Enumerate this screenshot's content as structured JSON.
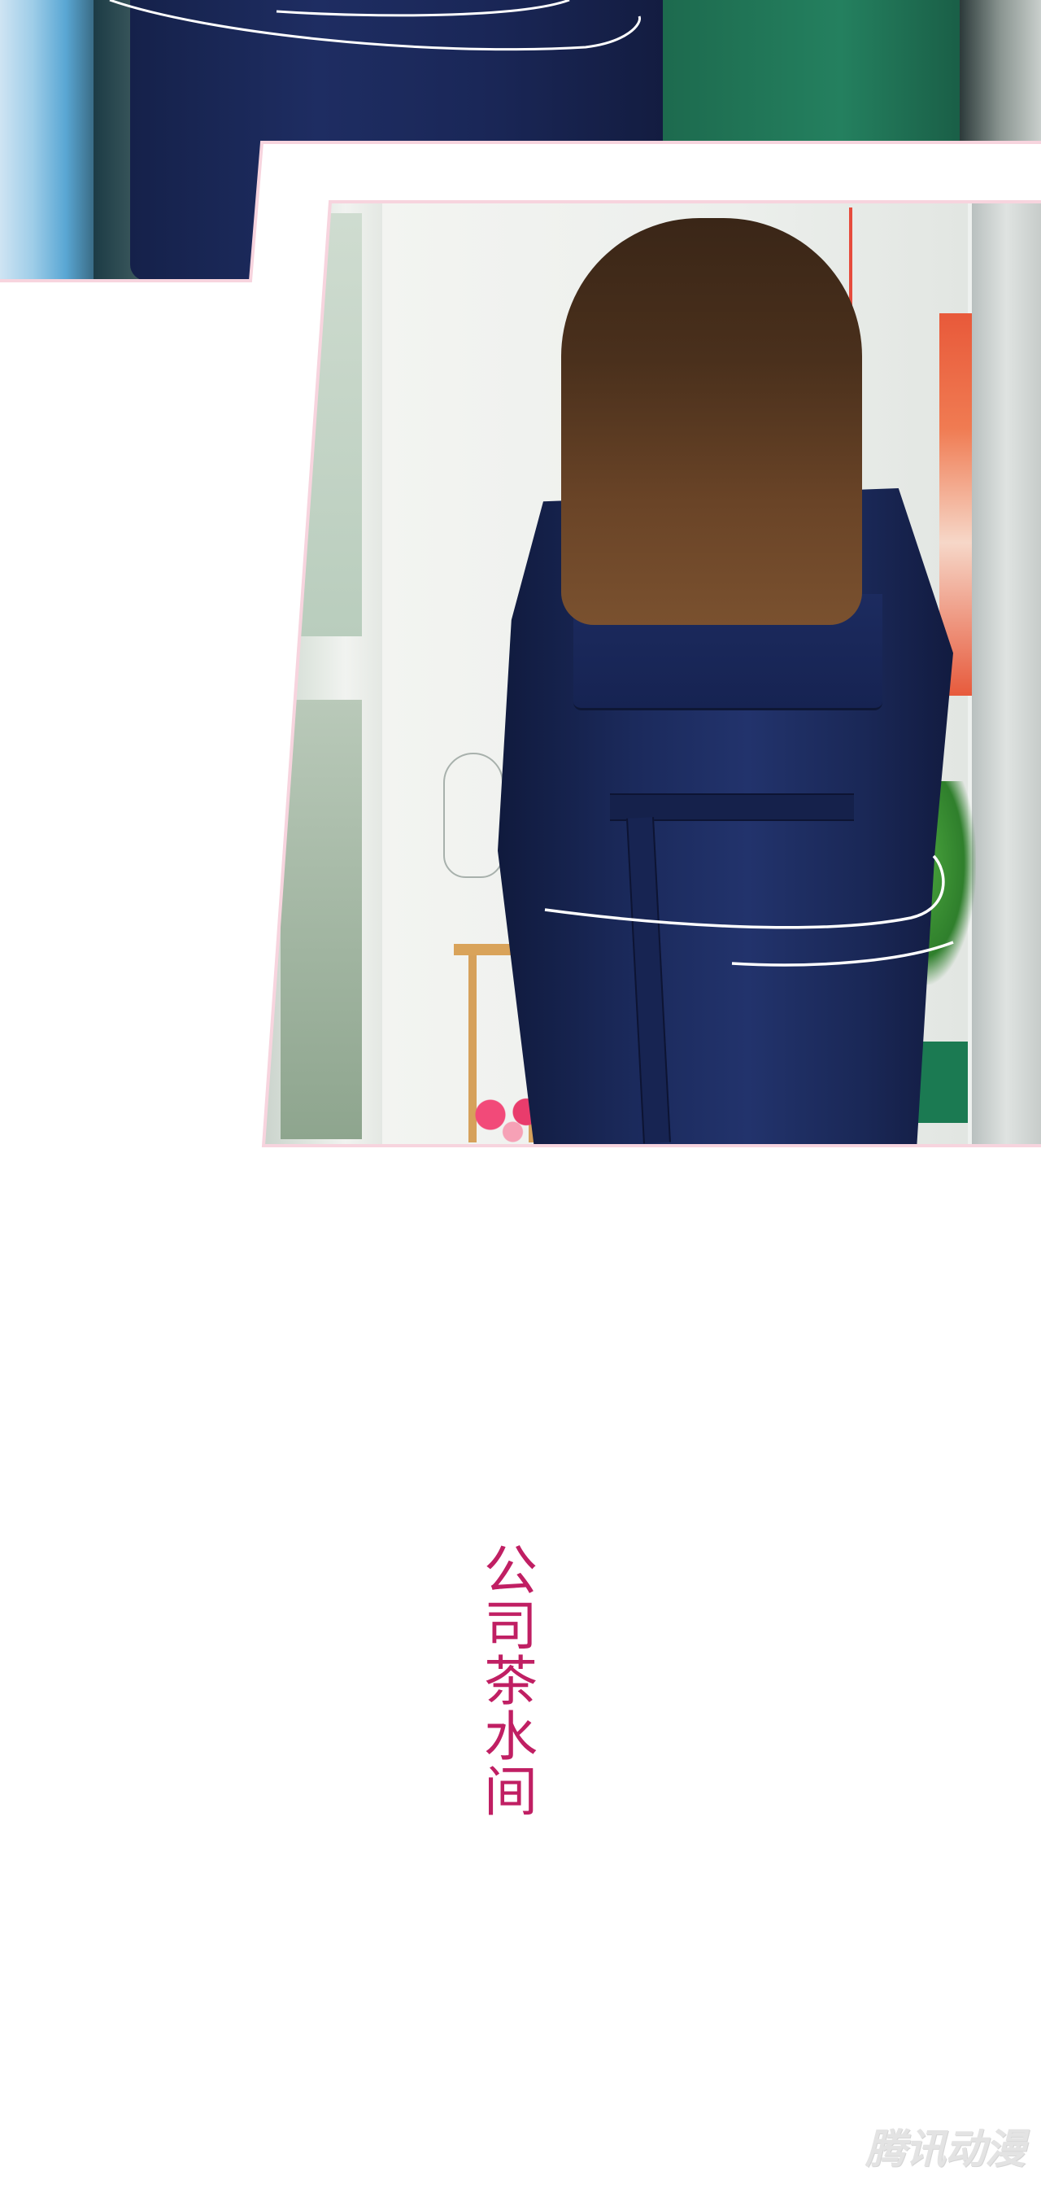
{
  "scene": {
    "main_photo": {
      "sign_text_1": "",
      "sign_text_2": ""
    }
  },
  "caption": {
    "text": "公司茶水间",
    "color": "#c01f63"
  },
  "watermark": {
    "text": "腾讯动漫"
  },
  "colors": {
    "border_accent": "#f7d4de",
    "coat": "#1b2a5c",
    "hair": "#5a3a21",
    "caption": "#c01f63"
  }
}
